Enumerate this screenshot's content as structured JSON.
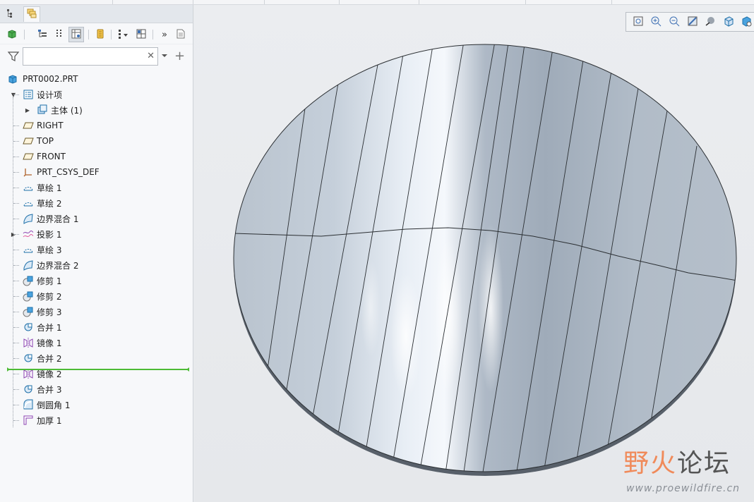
{
  "app": {
    "accent": "#1a7fd1",
    "selection_line_color": "#4dbb35"
  },
  "panel_tabs": [
    {
      "name": "model-tree-tab-icon",
      "active": true
    },
    {
      "name": "layers-tab-icon",
      "active": false
    }
  ],
  "tree_toolbar": {
    "icons": [
      "feature-solid-icon",
      "tree-columns-icon",
      "tree-filter-icon",
      "show-tree-icon",
      "settings-icon",
      "tree-options-icon",
      "table-icon",
      "more-icon",
      "notes-icon"
    ]
  },
  "filter": {
    "value": "",
    "placeholder": ""
  },
  "tree": {
    "root": {
      "label": "PRT0002.PRT",
      "icon": "part-icon"
    },
    "items": [
      {
        "label": "设计项",
        "icon": "design-items-icon",
        "expanded": true,
        "indent": 1
      },
      {
        "label": "主体 (1)",
        "icon": "body-icon",
        "expanded": false,
        "indent": 2
      },
      {
        "label": "RIGHT",
        "icon": "datum-plane-icon",
        "indent": 1
      },
      {
        "label": "TOP",
        "icon": "datum-plane-icon",
        "indent": 1
      },
      {
        "label": "FRONT",
        "icon": "datum-plane-icon",
        "indent": 1
      },
      {
        "label": "PRT_CSYS_DEF",
        "icon": "coordinate-system-icon",
        "indent": 1
      },
      {
        "label": "草绘 1",
        "icon": "sketch-icon",
        "indent": 1
      },
      {
        "label": "草绘 2",
        "icon": "sketch-icon",
        "indent": 1
      },
      {
        "label": "边界混合 1",
        "icon": "boundary-blend-icon",
        "indent": 1
      },
      {
        "label": "投影 1",
        "icon": "projection-icon",
        "expanded": false,
        "indent": 1
      },
      {
        "label": "草绘 3",
        "icon": "sketch-icon",
        "indent": 1
      },
      {
        "label": "边界混合 2",
        "icon": "boundary-blend-icon",
        "indent": 1
      },
      {
        "label": "修剪 1",
        "icon": "trim-icon",
        "indent": 1
      },
      {
        "label": "修剪 2",
        "icon": "trim-icon",
        "indent": 1
      },
      {
        "label": "修剪 3",
        "icon": "trim-icon",
        "indent": 1
      },
      {
        "label": "合并 1",
        "icon": "merge-icon",
        "indent": 1
      },
      {
        "label": "镜像 1",
        "icon": "mirror-icon",
        "indent": 1
      },
      {
        "label": "合并 2",
        "icon": "merge-icon",
        "indent": 1
      },
      {
        "label": "镜像 2",
        "icon": "mirror-icon",
        "indent": 1
      },
      {
        "label": "合并 3",
        "icon": "merge-icon",
        "indent": 1
      },
      {
        "label": "倒圆角 1",
        "icon": "round-icon",
        "indent": 1
      },
      {
        "label": "加厚 1",
        "icon": "thicken-icon",
        "indent": 1
      }
    ]
  },
  "view_toolbar": {
    "icons": [
      "refit-icon",
      "zoom-in-icon",
      "zoom-out-icon",
      "repaint-icon",
      "display-style-icon",
      "saved-orientations-icon",
      "view-manager-icon"
    ]
  },
  "watermark": {
    "brand_part1": "野火",
    "brand_part2": "论坛",
    "url": "www.proewildfire.cn"
  }
}
